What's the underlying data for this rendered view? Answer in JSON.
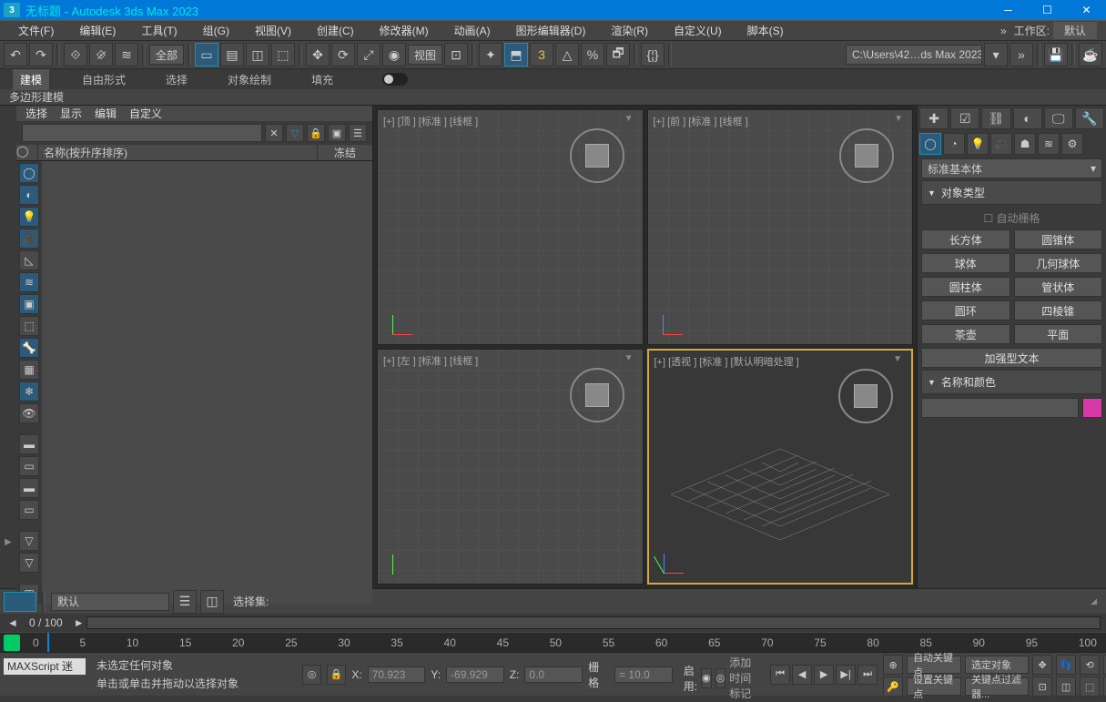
{
  "title": "无标题 - Autodesk 3ds Max 2023",
  "menubar": [
    "文件(F)",
    "编辑(E)",
    "工具(T)",
    "组(G)",
    "视图(V)",
    "创建(C)",
    "修改器(M)",
    "动画(A)",
    "图形编辑器(D)",
    "渲染(R)",
    "自定义(U)",
    "脚本(S)"
  ],
  "workspace": {
    "label": "工作区:",
    "value": "默认"
  },
  "toolbar": {
    "scope": "全部",
    "viewdrop": "视图",
    "path": "C:\\Users\\42…ds Max 2023"
  },
  "ribbon": {
    "tabs": [
      "建模",
      "自由形式",
      "选择",
      "对象绘制",
      "填充"
    ],
    "sub": "多边形建模"
  },
  "scene": {
    "menu": [
      "选择",
      "显示",
      "编辑",
      "自定义"
    ],
    "col_name": "名称(按升序排序)",
    "col_freeze": "冻结"
  },
  "viewports": {
    "top": {
      "label": "[+] [顶 ] [标准 ] [线框 ]"
    },
    "front": {
      "label": "[+] [前 ] [标准 ] [线框 ]"
    },
    "left": {
      "label": "[+] [左 ] [标准 ] [线框 ]"
    },
    "persp": {
      "label": "[+] [透视 ] [标准 ] [默认明暗处理 ]"
    }
  },
  "cmdpanel": {
    "category": "标准基本体",
    "roll_objtype": "对象类型",
    "autogrid": "自动栅格",
    "prims": [
      "长方体",
      "圆锥体",
      "球体",
      "几何球体",
      "圆柱体",
      "管状体",
      "圆环",
      "四棱锥",
      "茶壶",
      "平面",
      "加强型文本"
    ],
    "roll_namecolor": "名称和颜色"
  },
  "layerbar": {
    "set": "默认",
    "selset_label": "选择集:"
  },
  "timeslider": {
    "frame": "0 / 100"
  },
  "ruler_ticks": [
    "0",
    "5",
    "10",
    "15",
    "20",
    "25",
    "30",
    "35",
    "40",
    "45",
    "50",
    "55",
    "60",
    "65",
    "70",
    "75",
    "80",
    "85",
    "90",
    "95",
    "100"
  ],
  "status": {
    "maxscript": "MAXScript 迷",
    "msg1": "未选定任何对象",
    "msg2": "单击或单击并拖动以选择对象",
    "x_lbl": "X:",
    "x": "70.923",
    "y_lbl": "Y:",
    "y": "-69.929",
    "z_lbl": "Z:",
    "z": "0.0",
    "grid_lbl": "栅格",
    "grid": "= 10.0",
    "enable_lbl": "启用:",
    "addtime": "添加时间标记",
    "autokey": "自动关键点",
    "setkey": "设置关键点",
    "seldrop": "选定对象",
    "filter": "关键点过滤器..."
  },
  "watermark": ""
}
